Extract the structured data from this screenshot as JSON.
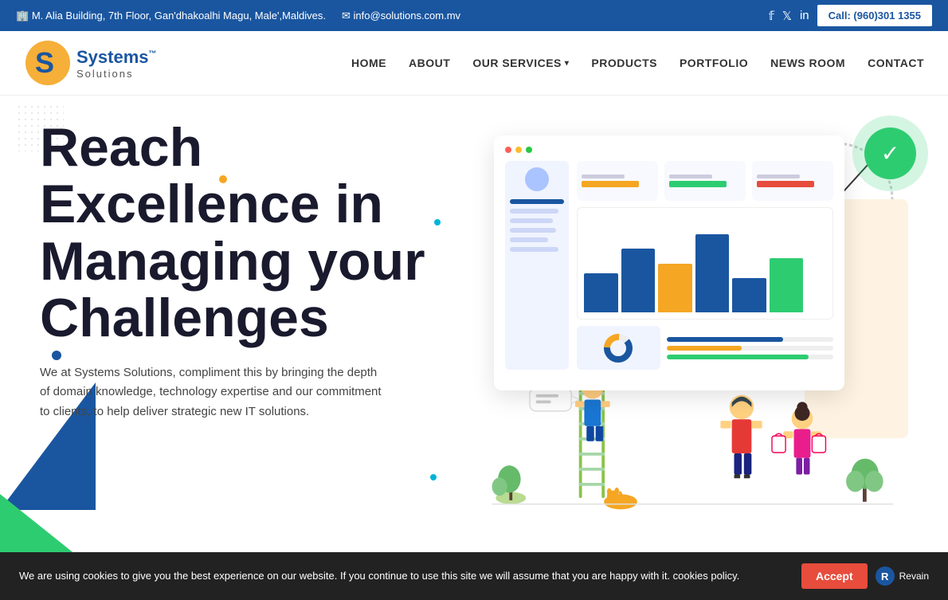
{
  "topbar": {
    "address": "M. Alia Building, 7th Floor, Gan'dhakoalhi Magu, Male',Maldives.",
    "email": "info@solutions.com.mv",
    "call_label": "Call: (960)301 1355",
    "social": [
      {
        "icon": "f",
        "name": "facebook",
        "glyph": "f"
      },
      {
        "icon": "t",
        "name": "twitter",
        "glyph": "𝕏"
      },
      {
        "icon": "in",
        "name": "linkedin",
        "glyph": "in"
      }
    ]
  },
  "navbar": {
    "logo_brand": "Systems™",
    "logo_sub": "Solutions",
    "links": [
      {
        "label": "HOME",
        "id": "home"
      },
      {
        "label": "ABOUT",
        "id": "about"
      },
      {
        "label": "OUR SERVICES",
        "id": "services",
        "has_dropdown": true
      },
      {
        "label": "PRODUCTS",
        "id": "products"
      },
      {
        "label": "PORTFOLIO",
        "id": "portfolio"
      },
      {
        "label": "NEWS ROOM",
        "id": "newsroom"
      },
      {
        "label": "CONTACT",
        "id": "contact"
      }
    ]
  },
  "hero": {
    "title": "Reach Excellence in Managing your Challenges",
    "description": "We at Systems Solutions, compliment this by bringing the depth of domain knowledge, technology expertise and our commitment to clients, to help deliver strategic new IT solutions."
  },
  "cookie": {
    "text": "We are using cookies to give you the best experience on our website. If you continue to use this site we will assume that you are happy with it. cookies policy.",
    "accept_label": "Accept",
    "revain_label": "Revain"
  }
}
